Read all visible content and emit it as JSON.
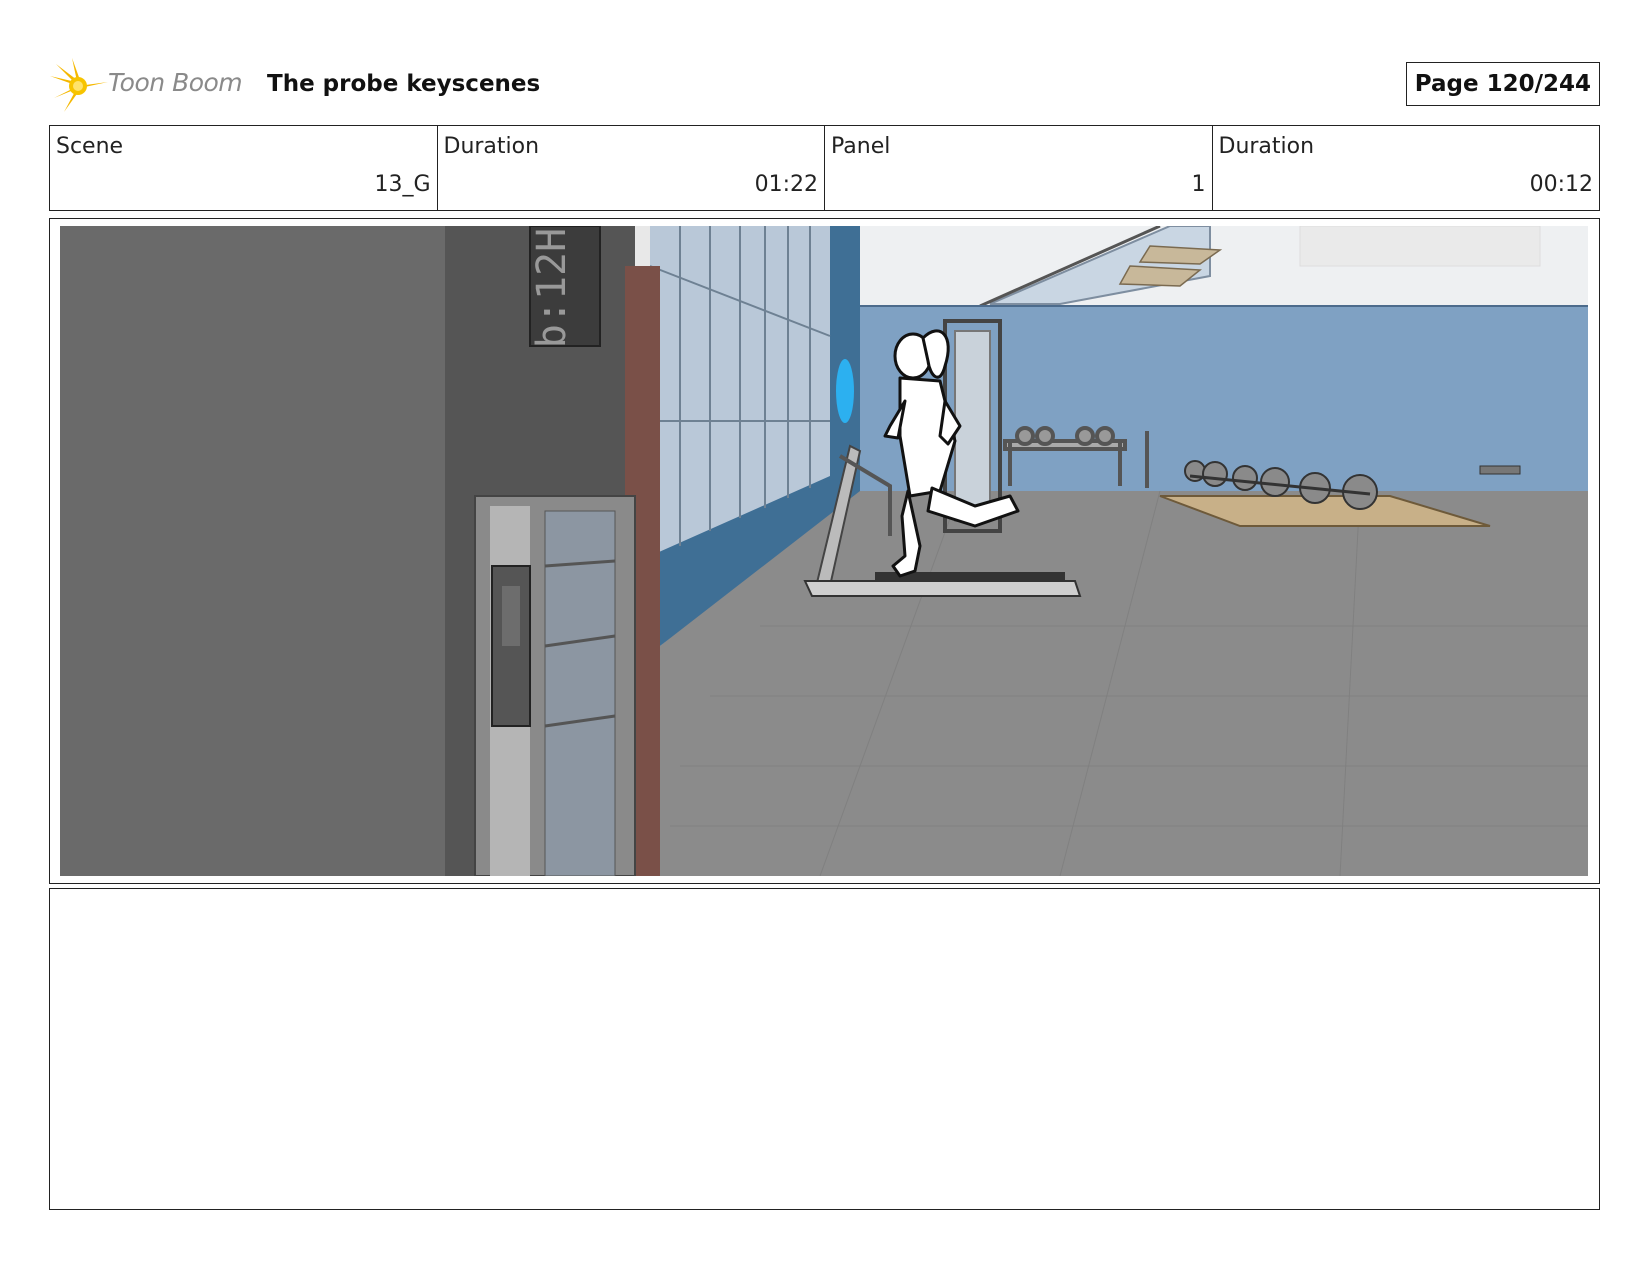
{
  "header": {
    "logo_text": "Toon Boom",
    "title": "The probe keyscenes",
    "page": "Page 120/244"
  },
  "info": {
    "scene_label": "Scene",
    "scene_value": "13_G",
    "scene_duration_label": "Duration",
    "scene_duration_value": "01:22",
    "panel_label": "Panel",
    "panel_value": "1",
    "panel_duration_label": "Duration",
    "panel_duration_value": "00:12"
  },
  "panel": {
    "display_text": "b:12H"
  },
  "notes": {
    "text": ""
  }
}
